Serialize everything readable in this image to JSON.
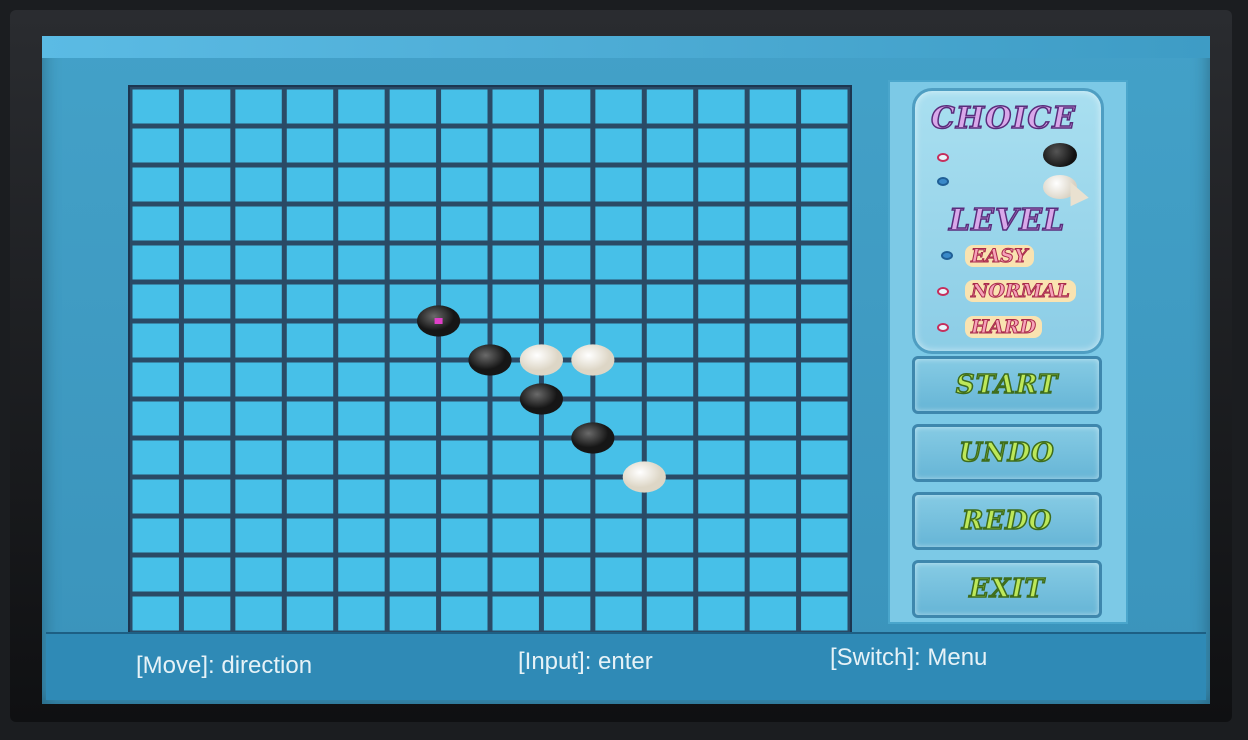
{
  "board": {
    "cols": 14,
    "rows": 14,
    "colors": {
      "cell": "#47c0e8",
      "line": "#1d3b57"
    },
    "stones": [
      {
        "col": 6,
        "row": 6,
        "color": "black",
        "marker": true
      },
      {
        "col": 7,
        "row": 7,
        "color": "black"
      },
      {
        "col": 8,
        "row": 7,
        "color": "white"
      },
      {
        "col": 9,
        "row": 7,
        "color": "white"
      },
      {
        "col": 8,
        "row": 8,
        "color": "black"
      },
      {
        "col": 9,
        "row": 9,
        "color": "black"
      },
      {
        "col": 10,
        "row": 10,
        "color": "white"
      }
    ]
  },
  "panel": {
    "choice_title": "CHOICE",
    "choice_options": [
      {
        "stone": "black",
        "selected": false
      },
      {
        "stone": "white",
        "selected": true
      }
    ],
    "level_title": "LEVEL",
    "levels": [
      {
        "label": "EASY",
        "selected": true
      },
      {
        "label": "NORMAL",
        "selected": false
      },
      {
        "label": "HARD",
        "selected": false
      }
    ],
    "buttons": {
      "start": "START",
      "undo": "UNDO",
      "redo": "REDO",
      "exit": "EXIT"
    }
  },
  "footer": {
    "move_hint": "[Move]: direction",
    "input_hint": "[Input]: enter",
    "switch_hint": "[Switch]: Menu"
  }
}
